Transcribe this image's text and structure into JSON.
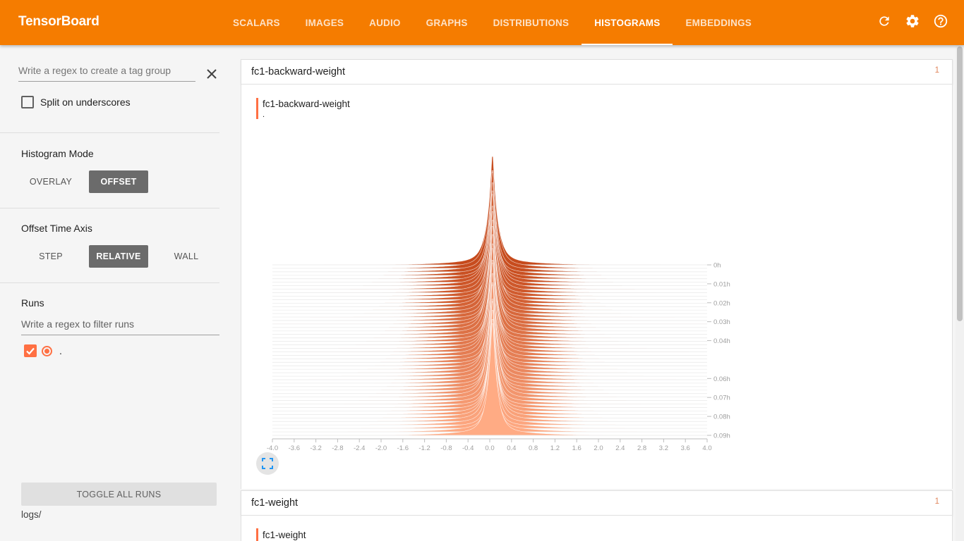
{
  "app": {
    "title": "TensorBoard"
  },
  "tabs": [
    {
      "label": "SCALARS"
    },
    {
      "label": "IMAGES"
    },
    {
      "label": "AUDIO"
    },
    {
      "label": "GRAPHS"
    },
    {
      "label": "DISTRIBUTIONS"
    },
    {
      "label": "HISTOGRAMS",
      "active": true
    },
    {
      "label": "EMBEDDINGS"
    }
  ],
  "icons": {
    "refresh": "refresh-icon",
    "settings": "gear-icon",
    "help": "help-icon"
  },
  "sidebar": {
    "tag_filter_placeholder": "Write a regex to create a tag group",
    "split_label": "Split on underscores",
    "histogram_mode": {
      "title": "Histogram Mode",
      "options": [
        "OVERLAY",
        "OFFSET"
      ],
      "selected": "OFFSET"
    },
    "offset_axis": {
      "title": "Offset Time Axis",
      "options": [
        "STEP",
        "RELATIVE",
        "WALL"
      ],
      "selected": "RELATIVE"
    },
    "runs": {
      "title": "Runs",
      "filter_placeholder": "Write a regex to filter runs",
      "items": [
        {
          "name": ".",
          "checked": true
        }
      ]
    },
    "toggle_all": "TOGGLE ALL RUNS",
    "logdir": "logs/"
  },
  "cards": [
    {
      "header": "fc1-backward-weight",
      "count": "1",
      "chart_title": "fc1-backward-weight",
      "run": "."
    },
    {
      "header": "fc1-weight",
      "count": "1",
      "chart_title": "fc1-weight"
    }
  ],
  "chart_data": {
    "type": "area",
    "title": "fc1-backward-weight",
    "mode": "offset",
    "x_ticks": [
      "-4.0",
      "-3.6",
      "-3.2",
      "-2.8",
      "-2.4",
      "-2.0",
      "-1.6",
      "-1.2",
      "-0.8",
      "-0.4",
      "0.0",
      "0.4",
      "0.8",
      "1.2",
      "1.6",
      "2.0",
      "2.4",
      "2.8",
      "3.2",
      "3.6",
      "4.0"
    ],
    "xlim": [
      -4.0,
      4.0
    ],
    "y_ticks": [
      "0h",
      "0.01h",
      "0.02h",
      "0.03h",
      "0.04h",
      "0.06h",
      "0.07h",
      "0.08h",
      "0.09h"
    ],
    "y_tick_values": [
      0,
      0.01,
      0.02,
      0.03,
      0.04,
      0.06,
      0.07,
      0.08,
      0.09
    ],
    "ylim": [
      0,
      0.09
    ],
    "series_count": 50,
    "peak_center": 0.05,
    "colors": {
      "oldest": "#c64a1c",
      "newest": "#ffab84"
    }
  }
}
